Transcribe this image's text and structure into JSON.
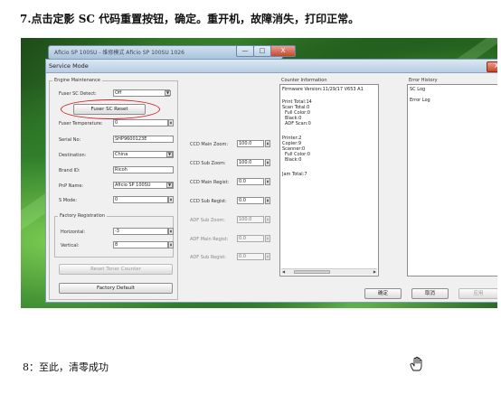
{
  "heading": "7.点击定影 SC 代码重置按钮，确定。重开机，故障消失，打印正常。",
  "footer": "8：至此，清零成功",
  "bg_window": {
    "title": "Aficio SP 100SU - 维修模式 Aficio SP 100SU 1026",
    "controls": [
      "—",
      "□",
      "X"
    ]
  },
  "dialog": {
    "title": "Service Mode",
    "close": "X",
    "engine": {
      "title": "Engine Maintenance",
      "rows": [
        {
          "label": "Fuser SC Detect:",
          "value": "Off"
        },
        {
          "label": "Fuser Temperature:",
          "value": "0"
        },
        {
          "label": "Serial No:",
          "value": "SHP9600123E"
        },
        {
          "label": "Destination:",
          "value": "China"
        },
        {
          "label": "Brand ID:",
          "value": "Ricoh"
        },
        {
          "label": "PnP Name:",
          "value": "Aficio SP 100SU"
        },
        {
          "label": "S Mode:",
          "value": "0"
        }
      ],
      "reset_button": "Fuser SC Reset",
      "factory_group": {
        "title": "Factory Registration",
        "rows": [
          {
            "label": "Horizontal:",
            "value": "-3"
          },
          {
            "label": "Vertical:",
            "value": "8"
          }
        ]
      },
      "reset_toner": "Reset Toner Counter",
      "factory_default": "Factory Default"
    },
    "ccd": {
      "rows": [
        {
          "label": "CCD Main Zoom:",
          "value": "100.0"
        },
        {
          "label": "CCD Sub Zoom:",
          "value": "100.0"
        },
        {
          "label": "CCD Main Regist:",
          "value": "0.0"
        },
        {
          "label": "CCD Sub Regist:",
          "value": "0.0"
        },
        {
          "label": "ADF Sub Zoom:",
          "value": "100.0"
        },
        {
          "label": "ADF Main Regist:",
          "value": "0.0"
        },
        {
          "label": "ADF Sub Regist:",
          "value": "0.0"
        }
      ]
    },
    "counter": {
      "title": "Counter Information",
      "lines": [
        "Firmware Version:11/29/17 V653 A1",
        "",
        "Print Total:14",
        "Scan Total:0",
        "  Full Color:0",
        "  Black:0",
        "  ADF Scan:0",
        "",
        "Printer:2",
        "Copier:9",
        "Scanner:0",
        "  Full Color:0",
        "  Black:0",
        "",
        "Jam Total:7"
      ]
    },
    "error": {
      "title": "Error History",
      "lines": [
        "SC Log",
        "",
        "Error Log"
      ]
    },
    "ok": "确定",
    "cancel": "取消",
    "apply": "应用"
  }
}
